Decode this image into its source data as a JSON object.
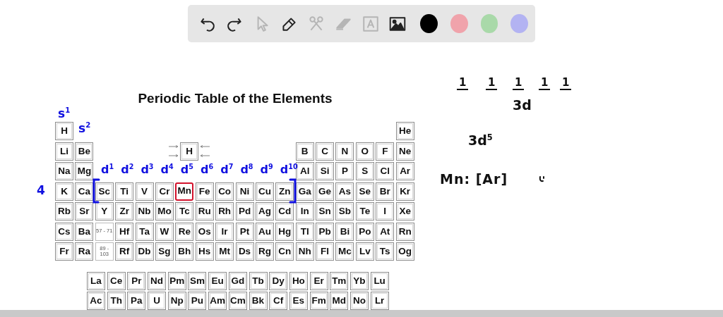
{
  "toolbar": {
    "tools": [
      {
        "kind": "undo",
        "disabled": false
      },
      {
        "kind": "redo",
        "disabled": false
      },
      {
        "kind": "pointer",
        "disabled": true
      },
      {
        "kind": "pencil",
        "disabled": false
      },
      {
        "kind": "tools",
        "disabled": true
      },
      {
        "kind": "eraser",
        "disabled": true
      },
      {
        "kind": "text",
        "disabled": true
      },
      {
        "kind": "image",
        "disabled": false
      }
    ],
    "colors": [
      {
        "color": "#000000"
      },
      {
        "color": "#f0a3ab"
      },
      {
        "color": "#a9d9a9"
      },
      {
        "color": "#b3b3f2"
      }
    ]
  },
  "document": {
    "title": "Periodic Table of the Elements",
    "legend": {
      "symbol": "H"
    },
    "periods": [
      {
        "s_block": [
          {
            "kind": "element",
            "symbol": "H",
            "highlighted": false
          }
        ],
        "p_block": [
          {
            "kind": "element",
            "symbol": "He",
            "highlighted": false
          }
        ]
      },
      {
        "s_block": [
          {
            "kind": "element",
            "symbol": "Li",
            "highlighted": false
          },
          {
            "kind": "element",
            "symbol": "Be",
            "highlighted": false
          }
        ],
        "p_block": [
          {
            "kind": "element",
            "symbol": "B",
            "highlighted": false
          },
          {
            "kind": "element",
            "symbol": "C",
            "highlighted": false
          },
          {
            "kind": "element",
            "symbol": "N",
            "highlighted": false
          },
          {
            "kind": "element",
            "symbol": "O",
            "highlighted": false
          },
          {
            "kind": "element",
            "symbol": "F",
            "highlighted": false
          },
          {
            "kind": "element",
            "symbol": "Ne",
            "highlighted": false
          }
        ]
      },
      {
        "s_block": [
          {
            "kind": "element",
            "symbol": "Na",
            "highlighted": false
          },
          {
            "kind": "element",
            "symbol": "Mg",
            "highlighted": false
          }
        ],
        "p_block": [
          {
            "kind": "element",
            "symbol": "Al",
            "highlighted": false
          },
          {
            "kind": "element",
            "symbol": "Si",
            "highlighted": false
          },
          {
            "kind": "element",
            "symbol": "P",
            "highlighted": false
          },
          {
            "kind": "element",
            "symbol": "S",
            "highlighted": false
          },
          {
            "kind": "element",
            "symbol": "Cl",
            "highlighted": false
          },
          {
            "kind": "element",
            "symbol": "Ar",
            "highlighted": false
          }
        ]
      },
      {
        "s_block": [
          {
            "kind": "element",
            "symbol": "K",
            "highlighted": false
          },
          {
            "kind": "element",
            "symbol": "Ca",
            "highlighted": false
          }
        ],
        "d_block": [
          {
            "kind": "element",
            "symbol": "Sc",
            "highlighted": false
          },
          {
            "kind": "element",
            "symbol": "Ti",
            "highlighted": false
          },
          {
            "kind": "element",
            "symbol": "V",
            "highlighted": false
          },
          {
            "kind": "element",
            "symbol": "Cr",
            "highlighted": false
          },
          {
            "kind": "element",
            "symbol": "Mn",
            "highlighted": true
          },
          {
            "kind": "element",
            "symbol": "Fe",
            "highlighted": false
          },
          {
            "kind": "element",
            "symbol": "Co",
            "highlighted": false
          },
          {
            "kind": "element",
            "symbol": "Ni",
            "highlighted": false
          },
          {
            "kind": "element",
            "symbol": "Cu",
            "highlighted": false
          },
          {
            "kind": "element",
            "symbol": "Zn",
            "highlighted": false
          }
        ],
        "p_block": [
          {
            "kind": "element",
            "symbol": "Ga",
            "highlighted": false
          },
          {
            "kind": "element",
            "symbol": "Ge",
            "highlighted": false
          },
          {
            "kind": "element",
            "symbol": "As",
            "highlighted": false
          },
          {
            "kind": "element",
            "symbol": "Se",
            "highlighted": false
          },
          {
            "kind": "element",
            "symbol": "Br",
            "highlighted": false
          },
          {
            "kind": "element",
            "symbol": "Kr",
            "highlighted": false
          }
        ]
      },
      {
        "s_block": [
          {
            "kind": "element",
            "symbol": "Rb",
            "highlighted": false
          },
          {
            "kind": "element",
            "symbol": "Sr",
            "highlighted": false
          }
        ],
        "d_block": [
          {
            "kind": "element",
            "symbol": "Y",
            "highlighted": false
          },
          {
            "kind": "element",
            "symbol": "Zr",
            "highlighted": false
          },
          {
            "kind": "element",
            "symbol": "Nb",
            "highlighted": false
          },
          {
            "kind": "element",
            "symbol": "Mo",
            "highlighted": false
          },
          {
            "kind": "element",
            "symbol": "Tc",
            "highlighted": false
          },
          {
            "kind": "element",
            "symbol": "Ru",
            "highlighted": false
          },
          {
            "kind": "element",
            "symbol": "Rh",
            "highlighted": false
          },
          {
            "kind": "element",
            "symbol": "Pd",
            "highlighted": false
          },
          {
            "kind": "element",
            "symbol": "Ag",
            "highlighted": false
          },
          {
            "kind": "element",
            "symbol": "Cd",
            "highlighted": false
          }
        ],
        "p_block": [
          {
            "kind": "element",
            "symbol": "In",
            "highlighted": false
          },
          {
            "kind": "element",
            "symbol": "Sn",
            "highlighted": false
          },
          {
            "kind": "element",
            "symbol": "Sb",
            "highlighted": false
          },
          {
            "kind": "element",
            "symbol": "Te",
            "highlighted": false
          },
          {
            "kind": "element",
            "symbol": "I",
            "highlighted": false
          },
          {
            "kind": "element",
            "symbol": "Xe",
            "highlighted": false
          }
        ]
      },
      {
        "s_block": [
          {
            "kind": "element",
            "symbol": "Cs",
            "highlighted": false
          },
          {
            "kind": "element",
            "symbol": "Ba",
            "highlighted": false
          }
        ],
        "d_block": [
          {
            "kind": "series",
            "label": "57 - 71"
          },
          {
            "kind": "element",
            "symbol": "Hf",
            "highlighted": false
          },
          {
            "kind": "element",
            "symbol": "Ta",
            "highlighted": false
          },
          {
            "kind": "element",
            "symbol": "W",
            "highlighted": false
          },
          {
            "kind": "element",
            "symbol": "Re",
            "highlighted": false
          },
          {
            "kind": "element",
            "symbol": "Os",
            "highlighted": false
          },
          {
            "kind": "element",
            "symbol": "Ir",
            "highlighted": false
          },
          {
            "kind": "element",
            "symbol": "Pt",
            "highlighted": false
          },
          {
            "kind": "element",
            "symbol": "Au",
            "highlighted": false
          },
          {
            "kind": "element",
            "symbol": "Hg",
            "highlighted": false
          }
        ],
        "p_block": [
          {
            "kind": "element",
            "symbol": "Tl",
            "highlighted": false
          },
          {
            "kind": "element",
            "symbol": "Pb",
            "highlighted": false
          },
          {
            "kind": "element",
            "symbol": "Bi",
            "highlighted": false
          },
          {
            "kind": "element",
            "symbol": "Po",
            "highlighted": false
          },
          {
            "kind": "element",
            "symbol": "At",
            "highlighted": false
          },
          {
            "kind": "element",
            "symbol": "Rn",
            "highlighted": false
          }
        ]
      },
      {
        "s_block": [
          {
            "kind": "element",
            "symbol": "Fr",
            "highlighted": false
          },
          {
            "kind": "element",
            "symbol": "Ra",
            "highlighted": false
          }
        ],
        "d_block": [
          {
            "kind": "series",
            "label": "89 - 103"
          },
          {
            "kind": "element",
            "symbol": "Rf",
            "highlighted": false
          },
          {
            "kind": "element",
            "symbol": "Db",
            "highlighted": false
          },
          {
            "kind": "element",
            "symbol": "Sg",
            "highlighted": false
          },
          {
            "kind": "element",
            "symbol": "Bh",
            "highlighted": false
          },
          {
            "kind": "element",
            "symbol": "Hs",
            "highlighted": false
          },
          {
            "kind": "element",
            "symbol": "Mt",
            "highlighted": false
          },
          {
            "kind": "element",
            "symbol": "Ds",
            "highlighted": false
          },
          {
            "kind": "element",
            "symbol": "Rg",
            "highlighted": false
          },
          {
            "kind": "element",
            "symbol": "Cn",
            "highlighted": false
          }
        ],
        "p_block": [
          {
            "kind": "element",
            "symbol": "Nh",
            "highlighted": false
          },
          {
            "kind": "element",
            "symbol": "Fl",
            "highlighted": false
          },
          {
            "kind": "element",
            "symbol": "Mc",
            "highlighted": false
          },
          {
            "kind": "element",
            "symbol": "Lv",
            "highlighted": false
          },
          {
            "kind": "element",
            "symbol": "Ts",
            "highlighted": false
          },
          {
            "kind": "element",
            "symbol": "Og",
            "highlighted": false
          }
        ]
      }
    ],
    "f_block": [
      [
        {
          "kind": "element",
          "symbol": "La",
          "highlighted": false
        },
        {
          "kind": "element",
          "symbol": "Ce",
          "highlighted": false
        },
        {
          "kind": "element",
          "symbol": "Pr",
          "highlighted": false
        },
        {
          "kind": "element",
          "symbol": "Nd",
          "highlighted": false
        },
        {
          "kind": "element",
          "symbol": "Pm",
          "highlighted": false
        },
        {
          "kind": "element",
          "symbol": "Sm",
          "highlighted": false
        },
        {
          "kind": "element",
          "symbol": "Eu",
          "highlighted": false
        },
        {
          "kind": "element",
          "symbol": "Gd",
          "highlighted": false
        },
        {
          "kind": "element",
          "symbol": "Tb",
          "highlighted": false
        },
        {
          "kind": "element",
          "symbol": "Dy",
          "highlighted": false
        },
        {
          "kind": "element",
          "symbol": "Ho",
          "highlighted": false
        },
        {
          "kind": "element",
          "symbol": "Er",
          "highlighted": false
        },
        {
          "kind": "element",
          "symbol": "Tm",
          "highlighted": false
        },
        {
          "kind": "element",
          "symbol": "Yb",
          "highlighted": false
        },
        {
          "kind": "element",
          "symbol": "Lu",
          "highlighted": false
        }
      ],
      [
        {
          "kind": "element",
          "symbol": "Ac",
          "highlighted": false
        },
        {
          "kind": "element",
          "symbol": "Th",
          "highlighted": false
        },
        {
          "kind": "element",
          "symbol": "Pa",
          "highlighted": false
        },
        {
          "kind": "element",
          "symbol": "U",
          "highlighted": false
        },
        {
          "kind": "element",
          "symbol": "Np",
          "highlighted": false
        },
        {
          "kind": "element",
          "symbol": "Pu",
          "highlighted": false
        },
        {
          "kind": "element",
          "symbol": "Am",
          "highlighted": false
        },
        {
          "kind": "element",
          "symbol": "Cm",
          "highlighted": false
        },
        {
          "kind": "element",
          "symbol": "Bk",
          "highlighted": false
        },
        {
          "kind": "element",
          "symbol": "Cf",
          "highlighted": false
        },
        {
          "kind": "element",
          "symbol": "Es",
          "highlighted": false
        },
        {
          "kind": "element",
          "symbol": "Fm",
          "highlighted": false
        },
        {
          "kind": "element",
          "symbol": "Md",
          "highlighted": false
        },
        {
          "kind": "element",
          "symbol": "No",
          "highlighted": false
        },
        {
          "kind": "element",
          "symbol": "Lr",
          "highlighted": false
        }
      ]
    ]
  },
  "annotations": {
    "s_labels": [
      "s$^{1}$",
      "s$^{2}$"
    ],
    "d_labels": [
      "d$^{1}$",
      "d$^{2}$",
      "d$^{3}$",
      "d$^{4}$",
      "d$^{5}$",
      "d$^{6}$",
      "d$^{7}$",
      "d$^{8}$",
      "d$^{9}$",
      "d$^{10}$"
    ],
    "period_label": "4"
  },
  "notes": {
    "orbitals": [
      "1",
      "1",
      "1",
      "1",
      "1"
    ],
    "orbital_label": "3d",
    "configuration": "3d$^{5}$",
    "notation": "Mn: [Ar]"
  }
}
